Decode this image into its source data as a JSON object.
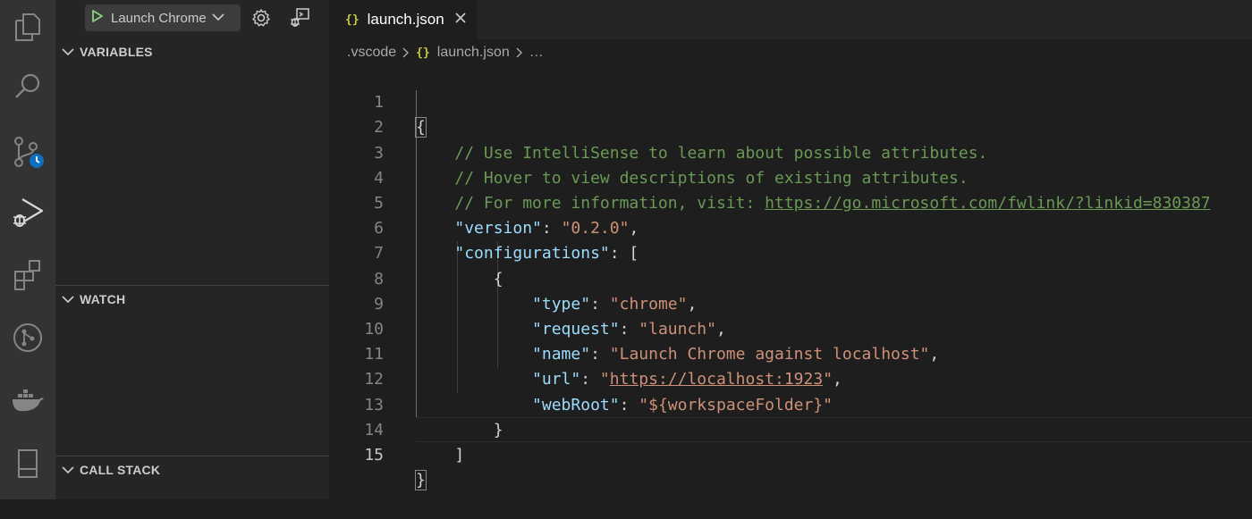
{
  "activity_bar": {
    "items": [
      {
        "icon": "explorer-icon"
      },
      {
        "icon": "search-icon"
      },
      {
        "icon": "source-control-icon"
      },
      {
        "icon": "run-debug-icon"
      },
      {
        "icon": "extensions-icon"
      },
      {
        "icon": "git-graph-icon"
      },
      {
        "icon": "docker-icon"
      },
      {
        "icon": "remote-explorer-icon"
      }
    ]
  },
  "debug_toolbar": {
    "config_label": "Launch Chrome",
    "settings_icon": "gear-icon",
    "debug_console_icon": "debug-console-icon"
  },
  "sidebar": {
    "sections": {
      "variables": "VARIABLES",
      "watch": "WATCH",
      "call_stack": "CALL STACK"
    }
  },
  "editor": {
    "tab": {
      "icon": "{}",
      "label": "launch.json"
    },
    "breadcrumb": {
      "folder": ".vscode",
      "icon": "{}",
      "file": "launch.json",
      "more": "…"
    },
    "line_numbers": [
      "1",
      "2",
      "3",
      "4",
      "5",
      "6",
      "7",
      "8",
      "9",
      "10",
      "11",
      "12",
      "13",
      "14",
      "15"
    ],
    "active_line": "15",
    "code": {
      "l1": "{",
      "l2": "// Use IntelliSense to learn about possible attributes.",
      "l3": "// Hover to view descriptions of existing attributes.",
      "l4_comment": "// For more information, visit: ",
      "l4_link": "https://go.microsoft.com/fwlink/?linkid=830387",
      "version_key": "\"version\"",
      "version_val": "\"0.2.0\"",
      "configurations_key": "\"configurations\"",
      "l7": "{",
      "type_key": "\"type\"",
      "type_val": "\"chrome\"",
      "request_key": "\"request\"",
      "request_val": "\"launch\"",
      "name_key": "\"name\"",
      "name_val": "\"Launch Chrome against localhost\"",
      "url_key": "\"url\"",
      "url_val_link": "https://localhost:1923",
      "webroot_key": "\"webRoot\"",
      "webroot_val": "\"${workspaceFolder}\"",
      "l13": "}",
      "l14": "]",
      "l15": "}"
    }
  },
  "colors": {
    "activity_bar": "#333333",
    "sidebar": "#252526",
    "editor": "#1e1e1e",
    "comment": "#6a9955",
    "key": "#9cdcfe",
    "string": "#ce9178",
    "accent_badge": "#0e70c0"
  }
}
